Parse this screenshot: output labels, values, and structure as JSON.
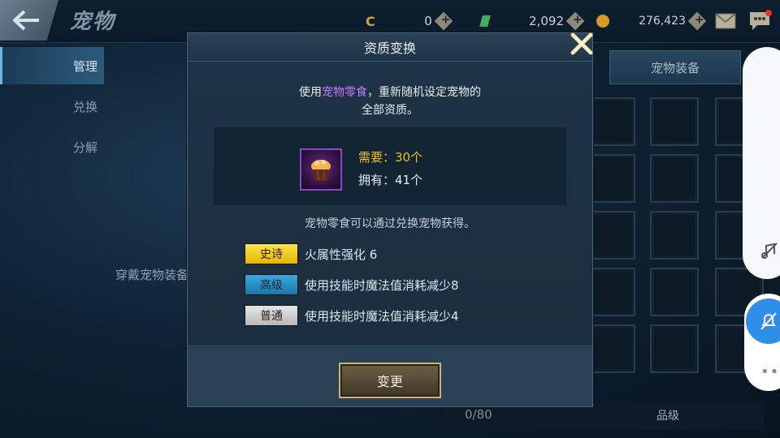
{
  "header": {
    "title": "宠物",
    "currencies": [
      {
        "icon": "gold-c-icon",
        "value": "0"
      },
      {
        "icon": "green-gem-icon",
        "value": "2,092"
      },
      {
        "icon": "gold-coin-icon",
        "value": "276,423"
      }
    ]
  },
  "sidebar": {
    "items": [
      {
        "label": "管理"
      },
      {
        "label": "兑换"
      },
      {
        "label": "分解"
      }
    ]
  },
  "background": {
    "wear_label": "穿戴宠物装备",
    "equip_tab": "宠物装备",
    "count": "0/80",
    "grade_label": "品级"
  },
  "dialog": {
    "title": "资质变换",
    "desc_prefix": "使用",
    "desc_highlight": "宠物零食",
    "desc_suffix": "，重新随机设定宠物的",
    "desc_line2": "全部资质。",
    "need": "需要：30个",
    "have": "拥有：41个",
    "obtain": "宠物零食可以通过兑换宠物获得。",
    "rows": [
      {
        "tag": "史诗",
        "text": "火属性强化 6"
      },
      {
        "tag": "高级",
        "text": "使用技能时魔法值消耗减少8"
      },
      {
        "tag": "普通",
        "text": "使用技能时魔法值消耗减少4"
      }
    ],
    "button": "变更"
  },
  "colors": {
    "accent": "#2f8fe8",
    "epic": "#ffe24a",
    "high": "#3aa7dc",
    "normal": "#d0d0d0",
    "highlight_text": "#c77bff",
    "need_text": "#f2c01e"
  }
}
